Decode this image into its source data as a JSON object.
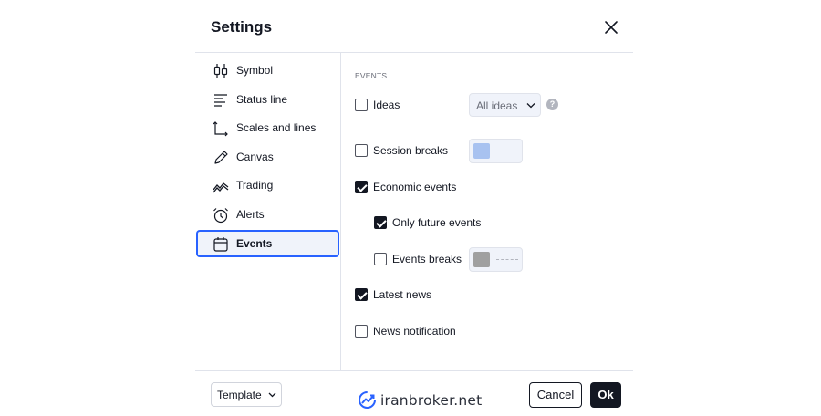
{
  "dialog": {
    "title": "Settings"
  },
  "sidebar": {
    "items": [
      {
        "label": "Symbol",
        "icon": "candlestick-icon"
      },
      {
        "label": "Status line",
        "icon": "status-line-icon"
      },
      {
        "label": "Scales and lines",
        "icon": "scales-icon"
      },
      {
        "label": "Canvas",
        "icon": "pencil-icon"
      },
      {
        "label": "Trading",
        "icon": "trading-icon"
      },
      {
        "label": "Alerts",
        "icon": "alarm-clock-icon"
      },
      {
        "label": "Events",
        "icon": "calendar-icon",
        "active": true
      }
    ]
  },
  "content": {
    "section_title": "EVENTS",
    "ideas": {
      "label": "Ideas",
      "checked": false,
      "select_value": "All ideas",
      "help": "?"
    },
    "session_breaks": {
      "label": "Session breaks",
      "checked": false,
      "color": "#a8c2f0"
    },
    "economic_events": {
      "label": "Economic events",
      "checked": true
    },
    "only_future_events": {
      "label": "Only future events",
      "checked": true
    },
    "events_breaks": {
      "label": "Events breaks",
      "checked": false,
      "color": "#a0a0a0"
    },
    "latest_news": {
      "label": "Latest news",
      "checked": true
    },
    "news_notification": {
      "label": "News notification",
      "checked": false
    }
  },
  "footer": {
    "template_label": "Template",
    "brand": "iranbroker.net",
    "cancel_label": "Cancel",
    "ok_label": "Ok"
  },
  "colors": {
    "accent": "#2962ff",
    "text": "#131722",
    "muted": "#6a6d78",
    "border": "#e0e3eb"
  }
}
